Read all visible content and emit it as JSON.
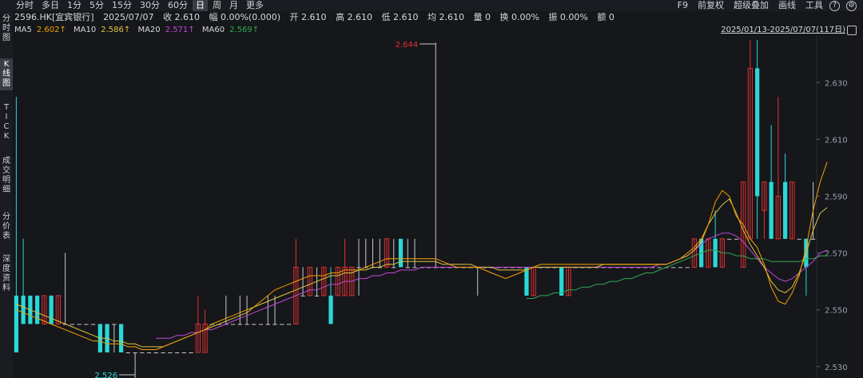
{
  "toolbar": {
    "periods": [
      "分时",
      "多日",
      "1分",
      "5分",
      "15分",
      "30分",
      "60分",
      "日",
      "周",
      "月",
      "更多"
    ],
    "active_period": "日",
    "tools": [
      "F9",
      "前复权",
      "超级叠加",
      "画线",
      "工具"
    ]
  },
  "sidebar": {
    "tabs": [
      "分时图",
      "K线图",
      "TICK",
      "成交明细",
      "分价表",
      "深度资料"
    ],
    "active": "K线图"
  },
  "quote": {
    "code": "2596.HK[宜宾银行]",
    "date": "2025/07/07",
    "close": "收 2.610",
    "change": "幅 0.00%(0.000)",
    "open": "开 2.610",
    "high": "高 2.610",
    "low": "低 2.610",
    "avg": "均 2.610",
    "volume": "量 0",
    "turnover": "换 0.00%",
    "amplitude": "振 0.00%",
    "amount": "额 0"
  },
  "ma": [
    {
      "label": "MA5",
      "value": "2.602↑",
      "color": "#f2a000"
    },
    {
      "label": "MA10",
      "value": "2.586↑",
      "color": "#e0c440"
    },
    {
      "label": "MA20",
      "value": "2.571↑",
      "color": "#c04ad8"
    },
    {
      "label": "MA60",
      "value": "2.569↑",
      "color": "#2fa84f"
    }
  ],
  "range_text": "2025/01/13-2025/07/07(117日)",
  "colors": {
    "up": "#e03030",
    "down": "#2ad8d8",
    "flat": "#c8c8c8",
    "ma5": "#f2a000",
    "ma10": "#e0c440",
    "ma20": "#c04ad8",
    "ma60": "#2fa84f",
    "axis": "#9aa0aa"
  },
  "chart_data": {
    "type": "candlestick",
    "ylim": [
      2.527,
      2.64
    ],
    "y_ticks": [
      "2.630",
      "2.610",
      "2.590",
      "2.570",
      "2.550",
      "2.530"
    ],
    "annotations": [
      {
        "text": "2.644",
        "index": 60,
        "value": 2.644,
        "color": "#e03030"
      },
      {
        "text": "2.526",
        "index": 17,
        "value": 2.526,
        "color": "#2ad8d8"
      }
    ],
    "candles": [
      {
        "o": 2.555,
        "h": 2.625,
        "l": 2.535,
        "c": 2.535
      },
      {
        "o": 2.555,
        "h": 2.575,
        "l": 2.545,
        "c": 2.545
      },
      {
        "o": 2.555,
        "h": 2.555,
        "l": 2.545,
        "c": 2.545
      },
      {
        "o": 2.555,
        "h": 2.555,
        "l": 2.545,
        "c": 2.545
      },
      {
        "o": 2.545,
        "h": 2.555,
        "l": 2.545,
        "c": 2.555
      },
      {
        "o": 2.555,
        "h": 2.555,
        "l": 2.545,
        "c": 2.545
      },
      {
        "o": 2.545,
        "h": 2.555,
        "l": 2.545,
        "c": 2.555
      },
      {
        "o": 2.545,
        "h": 2.57,
        "l": 2.545,
        "c": 2.545
      },
      {
        "o": 2.545,
        "h": 2.545,
        "l": 2.545,
        "c": 2.545
      },
      {
        "o": 2.545,
        "h": 2.545,
        "l": 2.545,
        "c": 2.545
      },
      {
        "o": 2.545,
        "h": 2.545,
        "l": 2.545,
        "c": 2.545
      },
      {
        "o": 2.545,
        "h": 2.545,
        "l": 2.545,
        "c": 2.545
      },
      {
        "o": 2.545,
        "h": 2.545,
        "l": 2.535,
        "c": 2.535
      },
      {
        "o": 2.545,
        "h": 2.545,
        "l": 2.535,
        "c": 2.535
      },
      {
        "o": 2.545,
        "h": 2.545,
        "l": 2.535,
        "c": 2.545
      },
      {
        "o": 2.545,
        "h": 2.545,
        "l": 2.535,
        "c": 2.535
      },
      {
        "o": 2.535,
        "h": 2.535,
        "l": 2.535,
        "c": 2.535
      },
      {
        "o": 2.535,
        "h": 2.535,
        "l": 2.526,
        "c": 2.535
      },
      {
        "o": 2.535,
        "h": 2.535,
        "l": 2.535,
        "c": 2.535
      },
      {
        "o": 2.535,
        "h": 2.535,
        "l": 2.535,
        "c": 2.535
      },
      {
        "o": 2.535,
        "h": 2.535,
        "l": 2.535,
        "c": 2.535
      },
      {
        "o": 2.535,
        "h": 2.535,
        "l": 2.535,
        "c": 2.535
      },
      {
        "o": 2.535,
        "h": 2.535,
        "l": 2.535,
        "c": 2.535
      },
      {
        "o": 2.535,
        "h": 2.535,
        "l": 2.535,
        "c": 2.535
      },
      {
        "o": 2.535,
        "h": 2.535,
        "l": 2.535,
        "c": 2.535
      },
      {
        "o": 2.535,
        "h": 2.535,
        "l": 2.535,
        "c": 2.535
      },
      {
        "o": 2.535,
        "h": 2.555,
        "l": 2.535,
        "c": 2.545
      },
      {
        "o": 2.535,
        "h": 2.55,
        "l": 2.535,
        "c": 2.545
      },
      {
        "o": 2.545,
        "h": 2.545,
        "l": 2.545,
        "c": 2.545
      },
      {
        "o": 2.545,
        "h": 2.545,
        "l": 2.545,
        "c": 2.545
      },
      {
        "o": 2.545,
        "h": 2.555,
        "l": 2.545,
        "c": 2.545
      },
      {
        "o": 2.545,
        "h": 2.545,
        "l": 2.545,
        "c": 2.545
      },
      {
        "o": 2.545,
        "h": 2.555,
        "l": 2.545,
        "c": 2.545
      },
      {
        "o": 2.545,
        "h": 2.555,
        "l": 2.545,
        "c": 2.545
      },
      {
        "o": 2.545,
        "h": 2.545,
        "l": 2.545,
        "c": 2.545
      },
      {
        "o": 2.545,
        "h": 2.545,
        "l": 2.545,
        "c": 2.545
      },
      {
        "o": 2.545,
        "h": 2.555,
        "l": 2.545,
        "c": 2.545
      },
      {
        "o": 2.545,
        "h": 2.555,
        "l": 2.545,
        "c": 2.545
      },
      {
        "o": 2.545,
        "h": 2.545,
        "l": 2.545,
        "c": 2.545
      },
      {
        "o": 2.545,
        "h": 2.545,
        "l": 2.545,
        "c": 2.545
      },
      {
        "o": 2.545,
        "h": 2.575,
        "l": 2.545,
        "c": 2.565
      },
      {
        "o": 2.555,
        "h": 2.565,
        "l": 2.555,
        "c": 2.555
      },
      {
        "o": 2.555,
        "h": 2.565,
        "l": 2.555,
        "c": 2.565
      },
      {
        "o": 2.555,
        "h": 2.565,
        "l": 2.555,
        "c": 2.555
      },
      {
        "o": 2.555,
        "h": 2.565,
        "l": 2.555,
        "c": 2.565
      },
      {
        "o": 2.555,
        "h": 2.565,
        "l": 2.545,
        "c": 2.545
      },
      {
        "o": 2.555,
        "h": 2.565,
        "l": 2.555,
        "c": 2.565
      },
      {
        "o": 2.555,
        "h": 2.575,
        "l": 2.555,
        "c": 2.565
      },
      {
        "o": 2.555,
        "h": 2.565,
        "l": 2.555,
        "c": 2.565
      },
      {
        "o": 2.565,
        "h": 2.575,
        "l": 2.555,
        "c": 2.565
      },
      {
        "o": 2.565,
        "h": 2.575,
        "l": 2.565,
        "c": 2.565
      },
      {
        "o": 2.565,
        "h": 2.575,
        "l": 2.565,
        "c": 2.565
      },
      {
        "o": 2.565,
        "h": 2.575,
        "l": 2.565,
        "c": 2.565
      },
      {
        "o": 2.565,
        "h": 2.575,
        "l": 2.565,
        "c": 2.575
      },
      {
        "o": 2.565,
        "h": 2.575,
        "l": 2.565,
        "c": 2.565
      },
      {
        "o": 2.575,
        "h": 2.575,
        "l": 2.565,
        "c": 2.565
      },
      {
        "o": 2.565,
        "h": 2.575,
        "l": 2.565,
        "c": 2.565
      },
      {
        "o": 2.565,
        "h": 2.575,
        "l": 2.565,
        "c": 2.565
      },
      {
        "o": 2.565,
        "h": 2.565,
        "l": 2.565,
        "c": 2.565
      },
      {
        "o": 2.565,
        "h": 2.565,
        "l": 2.565,
        "c": 2.565
      },
      {
        "o": 2.565,
        "h": 2.644,
        "l": 2.565,
        "c": 2.565
      },
      {
        "o": 2.565,
        "h": 2.565,
        "l": 2.565,
        "c": 2.565
      },
      {
        "o": 2.565,
        "h": 2.565,
        "l": 2.565,
        "c": 2.565
      },
      {
        "o": 2.565,
        "h": 2.565,
        "l": 2.565,
        "c": 2.565
      },
      {
        "o": 2.565,
        "h": 2.565,
        "l": 2.565,
        "c": 2.565
      },
      {
        "o": 2.565,
        "h": 2.565,
        "l": 2.565,
        "c": 2.565
      },
      {
        "o": 2.565,
        "h": 2.565,
        "l": 2.555,
        "c": 2.565
      },
      {
        "o": 2.565,
        "h": 2.565,
        "l": 2.565,
        "c": 2.565
      },
      {
        "o": 2.565,
        "h": 2.565,
        "l": 2.565,
        "c": 2.565
      },
      {
        "o": 2.565,
        "h": 2.565,
        "l": 2.565,
        "c": 2.565
      },
      {
        "o": 2.565,
        "h": 2.565,
        "l": 2.565,
        "c": 2.565
      },
      {
        "o": 2.565,
        "h": 2.565,
        "l": 2.565,
        "c": 2.565
      },
      {
        "o": 2.565,
        "h": 2.565,
        "l": 2.565,
        "c": 2.565
      },
      {
        "o": 2.565,
        "h": 2.565,
        "l": 2.555,
        "c": 2.555
      },
      {
        "o": 2.555,
        "h": 2.565,
        "l": 2.555,
        "c": 2.565
      },
      {
        "o": 2.565,
        "h": 2.565,
        "l": 2.565,
        "c": 2.565
      },
      {
        "o": 2.565,
        "h": 2.565,
        "l": 2.565,
        "c": 2.565
      },
      {
        "o": 2.565,
        "h": 2.565,
        "l": 2.565,
        "c": 2.565
      },
      {
        "o": 2.565,
        "h": 2.565,
        "l": 2.555,
        "c": 2.555
      },
      {
        "o": 2.555,
        "h": 2.565,
        "l": 2.555,
        "c": 2.565
      },
      {
        "o": 2.565,
        "h": 2.565,
        "l": 2.565,
        "c": 2.565
      },
      {
        "o": 2.565,
        "h": 2.565,
        "l": 2.565,
        "c": 2.565
      },
      {
        "o": 2.565,
        "h": 2.565,
        "l": 2.565,
        "c": 2.565
      },
      {
        "o": 2.565,
        "h": 2.565,
        "l": 2.565,
        "c": 2.565
      },
      {
        "o": 2.565,
        "h": 2.565,
        "l": 2.565,
        "c": 2.565
      },
      {
        "o": 2.565,
        "h": 2.565,
        "l": 2.565,
        "c": 2.565
      },
      {
        "o": 2.565,
        "h": 2.565,
        "l": 2.565,
        "c": 2.565
      },
      {
        "o": 2.565,
        "h": 2.565,
        "l": 2.565,
        "c": 2.565
      },
      {
        "o": 2.565,
        "h": 2.565,
        "l": 2.565,
        "c": 2.565
      },
      {
        "o": 2.565,
        "h": 2.565,
        "l": 2.565,
        "c": 2.565
      },
      {
        "o": 2.565,
        "h": 2.565,
        "l": 2.565,
        "c": 2.565
      },
      {
        "o": 2.565,
        "h": 2.565,
        "l": 2.565,
        "c": 2.565
      },
      {
        "o": 2.565,
        "h": 2.565,
        "l": 2.565,
        "c": 2.565
      },
      {
        "o": 2.565,
        "h": 2.565,
        "l": 2.565,
        "c": 2.565
      },
      {
        "o": 2.565,
        "h": 2.565,
        "l": 2.565,
        "c": 2.565
      },
      {
        "o": 2.565,
        "h": 2.565,
        "l": 2.565,
        "c": 2.565
      },
      {
        "o": 2.565,
        "h": 2.565,
        "l": 2.565,
        "c": 2.565
      },
      {
        "o": 2.565,
        "h": 2.575,
        "l": 2.565,
        "c": 2.575
      },
      {
        "o": 2.575,
        "h": 2.575,
        "l": 2.565,
        "c": 2.565
      },
      {
        "o": 2.565,
        "h": 2.575,
        "l": 2.565,
        "c": 2.575
      },
      {
        "o": 2.575,
        "h": 2.585,
        "l": 2.565,
        "c": 2.565
      },
      {
        "o": 2.565,
        "h": 2.575,
        "l": 2.565,
        "c": 2.575
      },
      {
        "o": 2.575,
        "h": 2.575,
        "l": 2.575,
        "c": 2.575
      },
      {
        "o": 2.575,
        "h": 2.575,
        "l": 2.575,
        "c": 2.575
      },
      {
        "o": 2.565,
        "h": 2.595,
        "l": 2.565,
        "c": 2.595
      },
      {
        "o": 2.575,
        "h": 2.645,
        "l": 2.575,
        "c": 2.635
      },
      {
        "o": 2.635,
        "h": 2.645,
        "l": 2.575,
        "c": 2.59
      },
      {
        "o": 2.585,
        "h": 2.595,
        "l": 2.575,
        "c": 2.595
      },
      {
        "o": 2.595,
        "h": 2.615,
        "l": 2.575,
        "c": 2.575
      },
      {
        "o": 2.575,
        "h": 2.625,
        "l": 2.575,
        "c": 2.59
      },
      {
        "o": 2.595,
        "h": 2.605,
        "l": 2.575,
        "c": 2.575
      },
      {
        "o": 2.575,
        "h": 2.595,
        "l": 2.575,
        "c": 2.595
      },
      {
        "o": 2.575,
        "h": 2.575,
        "l": 2.575,
        "c": 2.575
      },
      {
        "o": 2.575,
        "h": 2.575,
        "l": 2.555,
        "c": 2.565
      },
      {
        "o": 2.575,
        "h": 2.595,
        "l": 2.575,
        "c": 2.575
      }
    ],
    "ma5": [
      2.55,
      2.549,
      2.548,
      2.547,
      2.546,
      2.545,
      2.544,
      2.543,
      2.542,
      2.541,
      2.54,
      2.539,
      2.539,
      2.538,
      2.538,
      2.538,
      2.537,
      2.537,
      2.536,
      2.536,
      2.536,
      2.537,
      2.538,
      2.539,
      2.54,
      2.541,
      2.542,
      2.543,
      2.545,
      2.546,
      2.547,
      2.548,
      2.549,
      2.55,
      2.551,
      2.553,
      2.555,
      2.557,
      2.558,
      2.559,
      2.56,
      2.561,
      2.562,
      2.562,
      2.562,
      2.563,
      2.563,
      2.564,
      2.564,
      2.564,
      2.565,
      2.566,
      2.567,
      2.568,
      2.568,
      2.568,
      2.568,
      2.568,
      2.568,
      2.568,
      2.568,
      2.567,
      2.566,
      2.565,
      2.565,
      2.565,
      2.565,
      2.564,
      2.563,
      2.562,
      2.561,
      2.562,
      2.563,
      2.564,
      2.565,
      2.566,
      2.566,
      2.566,
      2.566,
      2.566,
      2.566,
      2.566,
      2.566,
      2.566,
      2.566,
      2.566,
      2.566,
      2.566,
      2.566,
      2.566,
      2.566,
      2.566,
      2.566,
      2.566,
      2.567,
      2.568,
      2.57,
      2.572,
      2.575,
      2.58,
      2.588,
      2.592,
      2.59,
      2.583,
      2.58,
      2.575,
      2.572,
      2.566,
      2.558,
      2.553,
      2.552,
      2.556,
      2.562,
      2.572,
      2.585,
      2.595,
      2.602
    ],
    "ma10": [
      2.552,
      2.551,
      2.55,
      2.549,
      2.548,
      2.547,
      2.546,
      2.545,
      2.544,
      2.543,
      2.542,
      2.541,
      2.54,
      2.54,
      2.539,
      2.539,
      2.538,
      2.538,
      2.537,
      2.537,
      2.537,
      2.537,
      2.538,
      2.539,
      2.54,
      2.541,
      2.542,
      2.543,
      2.544,
      2.545,
      2.546,
      2.547,
      2.548,
      2.549,
      2.551,
      2.552,
      2.553,
      2.554,
      2.555,
      2.556,
      2.557,
      2.558,
      2.559,
      2.56,
      2.561,
      2.562,
      2.562,
      2.563,
      2.563,
      2.564,
      2.564,
      2.565,
      2.565,
      2.566,
      2.566,
      2.567,
      2.567,
      2.567,
      2.567,
      2.567,
      2.567,
      2.566,
      2.566,
      2.566,
      2.566,
      2.566,
      2.565,
      2.565,
      2.565,
      2.564,
      2.564,
      2.564,
      2.564,
      2.564,
      2.565,
      2.565,
      2.565,
      2.565,
      2.565,
      2.565,
      2.565,
      2.565,
      2.565,
      2.565,
      2.566,
      2.566,
      2.566,
      2.566,
      2.566,
      2.566,
      2.566,
      2.566,
      2.566,
      2.566,
      2.567,
      2.568,
      2.569,
      2.571,
      2.574,
      2.58,
      2.584,
      2.587,
      2.589,
      2.584,
      2.578,
      2.573,
      2.569,
      2.565,
      2.56,
      2.557,
      2.556,
      2.558,
      2.563,
      2.57,
      2.578,
      2.584,
      2.586
    ],
    "ma20": [
      null,
      null,
      null,
      null,
      null,
      null,
      null,
      null,
      null,
      null,
      null,
      null,
      null,
      null,
      null,
      null,
      null,
      null,
      null,
      null,
      2.54,
      2.54,
      2.54,
      2.541,
      2.541,
      2.542,
      2.542,
      2.543,
      2.543,
      2.544,
      2.545,
      2.546,
      2.547,
      2.548,
      2.549,
      2.55,
      2.551,
      2.552,
      2.553,
      2.554,
      2.555,
      2.556,
      2.557,
      2.557,
      2.558,
      2.559,
      2.559,
      2.56,
      2.56,
      2.561,
      2.561,
      2.562,
      2.562,
      2.563,
      2.563,
      2.564,
      2.564,
      2.564,
      2.565,
      2.565,
      2.565,
      2.565,
      2.565,
      2.565,
      2.565,
      2.565,
      2.565,
      2.565,
      2.565,
      2.565,
      2.565,
      2.565,
      2.565,
      2.565,
      2.565,
      2.565,
      2.565,
      2.565,
      2.565,
      2.565,
      2.565,
      2.565,
      2.565,
      2.565,
      2.565,
      2.565,
      2.565,
      2.565,
      2.565,
      2.565,
      2.565,
      2.565,
      2.566,
      2.566,
      2.567,
      2.568,
      2.569,
      2.571,
      2.573,
      2.575,
      2.576,
      2.577,
      2.577,
      2.576,
      2.574,
      2.571,
      2.568,
      2.565,
      2.563,
      2.561,
      2.56,
      2.561,
      2.563,
      2.565,
      2.567,
      2.57,
      2.571
    ],
    "ma60": [
      null,
      null,
      null,
      null,
      null,
      null,
      null,
      null,
      null,
      null,
      null,
      null,
      null,
      null,
      null,
      null,
      null,
      null,
      null,
      null,
      null,
      null,
      null,
      null,
      null,
      null,
      null,
      null,
      null,
      null,
      null,
      null,
      null,
      null,
      null,
      null,
      null,
      null,
      null,
      null,
      null,
      null,
      null,
      null,
      null,
      null,
      null,
      null,
      null,
      null,
      null,
      null,
      null,
      null,
      null,
      null,
      null,
      null,
      null,
      null,
      null,
      null,
      null,
      null,
      null,
      null,
      null,
      null,
      null,
      null,
      null,
      null,
      null,
      2.554,
      2.554,
      2.555,
      2.555,
      2.556,
      2.556,
      2.557,
      2.557,
      2.558,
      2.558,
      2.559,
      2.559,
      2.56,
      2.56,
      2.561,
      2.561,
      2.562,
      2.563,
      2.563,
      2.564,
      2.565,
      2.566,
      2.567,
      2.568,
      2.569,
      2.57,
      2.571,
      2.571,
      2.57,
      2.57,
      2.569,
      2.569,
      2.568,
      2.568,
      2.568,
      2.567,
      2.567,
      2.567,
      2.567,
      2.567,
      2.568,
      2.568,
      2.569,
      2.569
    ]
  }
}
